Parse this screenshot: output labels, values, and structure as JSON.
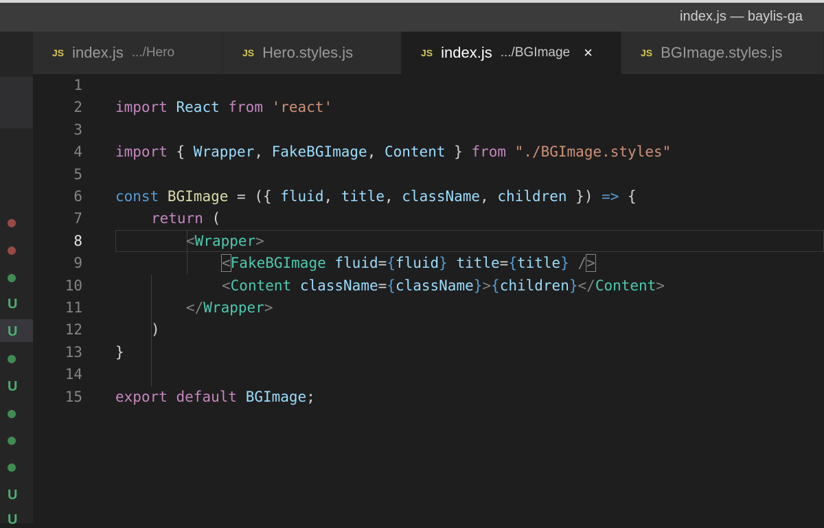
{
  "window": {
    "title": "index.js — baylis-ga"
  },
  "tabs": [
    {
      "icon": "JS",
      "name": "index.js",
      "description": ".../Hero"
    },
    {
      "icon": "JS",
      "name": "Hero.styles.js",
      "description": ""
    },
    {
      "icon": "JS",
      "name": "index.js",
      "description": ".../BGImage",
      "close": "×"
    },
    {
      "icon": "JS",
      "name": "BGImage.styles.js",
      "description": ""
    }
  ],
  "gutter": {
    "status_marks": [
      "U",
      "U",
      "U",
      "U",
      "U"
    ]
  },
  "editor": {
    "current_line": 8,
    "line_numbers": [
      "1",
      "2",
      "3",
      "4",
      "5",
      "6",
      "7",
      "8",
      "9",
      "10",
      "11",
      "12",
      "13",
      "14",
      "15"
    ],
    "lines": {
      "l1": [
        "import",
        " ",
        "React",
        " ",
        "from",
        " ",
        "'react'"
      ],
      "l3": [
        "import",
        " { ",
        "Wrapper",
        ", ",
        "FakeBGImage",
        ", ",
        "Content",
        " } ",
        "from",
        " ",
        "\"./BGImage.styles\""
      ],
      "l5": [
        "const",
        " ",
        "BGImage",
        " = ({ ",
        "fluid",
        ", ",
        "title",
        ", ",
        "className",
        ", ",
        "children",
        " }) ",
        "=>",
        " {"
      ],
      "l6": [
        "return",
        " ("
      ],
      "l7": [
        "<",
        "Wrapper",
        ">"
      ],
      "l8": [
        "<",
        "FakeBGImage",
        " ",
        "fluid",
        "=",
        "{",
        "fluid",
        "}",
        " ",
        "title",
        "=",
        "{",
        "title",
        "}",
        " /",
        ">"
      ],
      "l9": [
        "<",
        "Content",
        " ",
        "className",
        "=",
        "{",
        "className",
        "}",
        ">",
        "{",
        "children",
        "}",
        "</",
        "Content",
        ">"
      ],
      "l10": [
        "</",
        "Wrapper",
        ">"
      ],
      "l11": [
        ")"
      ],
      "l12": [
        "}"
      ],
      "l14": [
        "export",
        " ",
        "default",
        " ",
        "BGImage",
        ";"
      ]
    }
  },
  "colors": {
    "keyword": "#c586c0",
    "storage": "#569cd6",
    "variable": "#9cdcfe",
    "function": "#dcdcaa",
    "string": "#ce9178",
    "tag": "#4ec9b0",
    "js_badge": "#d6c94f",
    "git_untracked": "#4caf70",
    "git_modified_dot": "#9a4a44"
  }
}
